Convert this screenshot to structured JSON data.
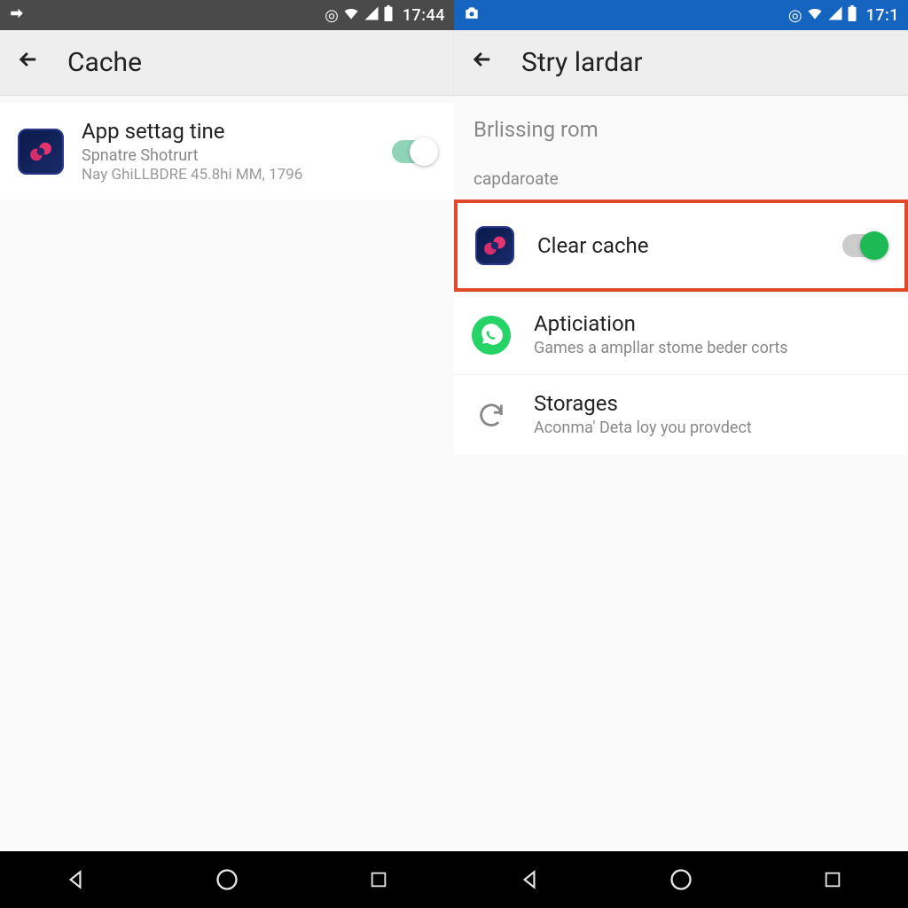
{
  "left": {
    "status": {
      "time": "17:44"
    },
    "appbar": {
      "title": "Cache"
    },
    "item": {
      "title": "App settag tine",
      "sub1": "Spnatre Shotrurt",
      "sub2": "Nay GhiLLBDRE 45.8hi MM, 1796"
    }
  },
  "right": {
    "status": {
      "time": "17:1"
    },
    "appbar": {
      "title": "Stry lardar"
    },
    "headerText": "Brlissing rom",
    "sectionLabel": "capdaroate",
    "items": [
      {
        "title": "Clear cache",
        "sub": ""
      },
      {
        "title": "Apticiation",
        "sub": "Games a ampllar stome beder corts"
      },
      {
        "title": "Storages",
        "sub": "Aconma' Deta loy you provdect"
      }
    ]
  }
}
